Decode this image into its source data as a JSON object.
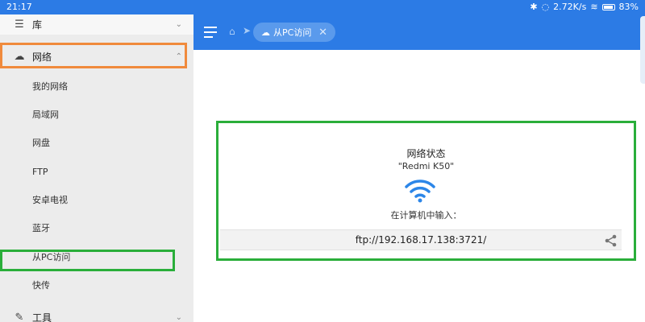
{
  "status_bar": {
    "time": "21:17",
    "net_speed": "2.72K/s",
    "battery": "83%",
    "icons": [
      "bluetooth-icon",
      "mute-icon",
      "wifi-icon",
      "battery-icon"
    ]
  },
  "sidebar": {
    "library": {
      "label": "库",
      "icon": "layers-icon"
    },
    "network": {
      "label": "网络",
      "icon": "router-icon",
      "expanded": true
    },
    "items": [
      "我的网络",
      "局域网",
      "网盘",
      "FTP",
      "安卓电视",
      "蓝牙",
      "从PC访问",
      "快传"
    ],
    "tools": {
      "label": "工具",
      "icon": "wrench-icon"
    }
  },
  "appbar": {
    "tab": {
      "label": "从PC访问",
      "icon": "router-icon"
    }
  },
  "card": {
    "title": "网络状态",
    "device": "\"Redmi K50\"",
    "prompt": "在计算机中输入：",
    "url": "ftp://192.168.17.138:3721/"
  },
  "colors": {
    "primary": "#2c7be5",
    "highlight_orange": "#f08a3c",
    "highlight_green": "#2aae3a",
    "wifi": "#2c86e8"
  }
}
